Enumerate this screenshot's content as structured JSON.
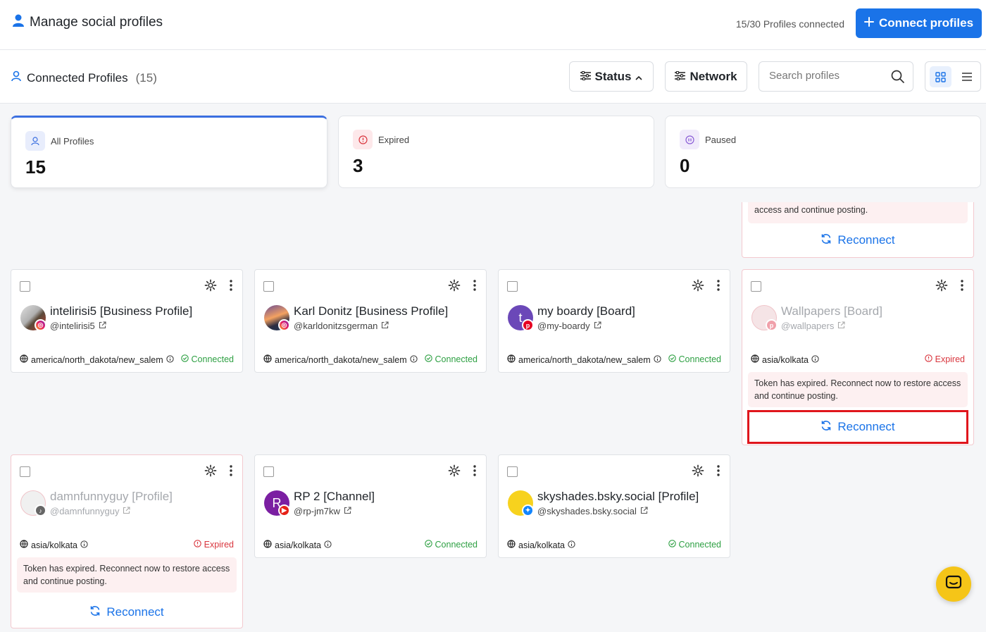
{
  "header": {
    "title": "Manage social profiles",
    "profiles_connected": "15/30 Profiles connected",
    "connect_button": "Connect profiles"
  },
  "subheader": {
    "title": "Connected Profiles",
    "count": "(15)",
    "status_filter": "Status",
    "network_filter": "Network",
    "search_placeholder": "Search profiles"
  },
  "stats": [
    {
      "label": "All Profiles",
      "value": "15"
    },
    {
      "label": "Expired",
      "value": "3"
    },
    {
      "label": "Paused",
      "value": "0"
    }
  ],
  "partial_card": {
    "warning": "access and continue posting.",
    "reconnect": "Reconnect"
  },
  "cards": [
    {
      "name": "intelirisi5 [Business Profile]",
      "handle": "@intelirisi5",
      "timezone": "america/north_dakota/new_salem",
      "status": "Connected",
      "network": "instagram"
    },
    {
      "name": "Karl Donitz [Business Profile]",
      "handle": "@karldonitzsgerman",
      "timezone": "america/north_dakota/new_salem",
      "status": "Connected",
      "network": "instagram"
    },
    {
      "name": "my boardy [Board]",
      "handle": "@my-boardy",
      "timezone": "america/north_dakota/new_salem",
      "status": "Connected",
      "network": "pinterest",
      "avatar_letter": "t"
    },
    {
      "name": "Wallpapers [Board]",
      "handle": "@wallpapers",
      "timezone": "asia/kolkata",
      "status": "Expired",
      "network": "pinterest",
      "warning": "Token has expired. Reconnect now to restore access and continue posting.",
      "reconnect": "Reconnect"
    },
    {
      "name": "damnfunnyguy [Profile]",
      "handle": "@damnfunnyguy",
      "timezone": "asia/kolkata",
      "status": "Expired",
      "network": "tiktok",
      "warning": "Token has expired. Reconnect now to restore access and continue posting.",
      "reconnect": "Reconnect"
    },
    {
      "name": "RP 2 [Channel]",
      "handle": "@rp-jm7kw",
      "timezone": "asia/kolkata",
      "status": "Connected",
      "network": "youtube",
      "avatar_letter": "R"
    },
    {
      "name": "skyshades.bsky.social [Profile]",
      "handle": "@skyshades.bsky.social",
      "timezone": "asia/kolkata",
      "status": "Connected",
      "network": "bluesky"
    }
  ],
  "colors": {
    "accent": "#1a73e8",
    "connected": "#2ea043",
    "expired": "#d9363e",
    "highlight": "#e0151c",
    "chat": "#f5c518"
  }
}
